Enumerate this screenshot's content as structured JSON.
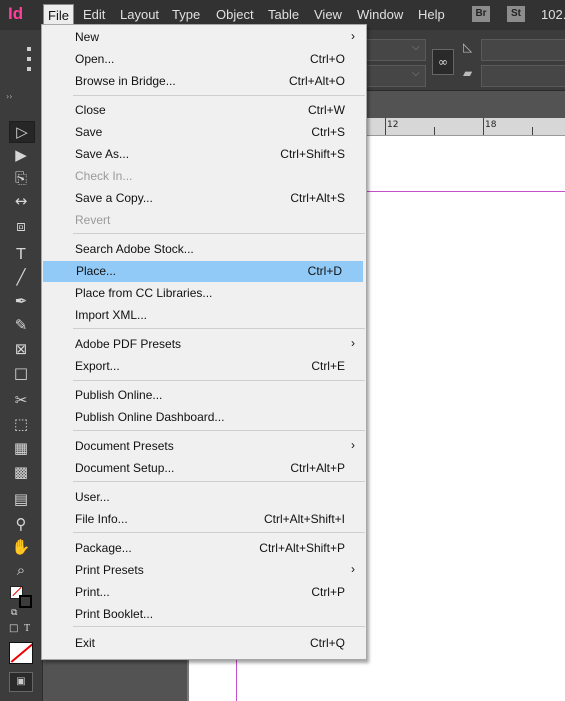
{
  "app": {
    "logo": "Id"
  },
  "menubar": {
    "items": [
      "File",
      "Edit",
      "Layout",
      "Type",
      "Object",
      "Table",
      "View",
      "Window",
      "Help"
    ],
    "badges": [
      "Br",
      "St"
    ],
    "zoom": "102."
  },
  "ruler": {
    "labels": [
      "12",
      "18"
    ]
  },
  "file_menu": {
    "highlighted": "Place...",
    "items": [
      {
        "label": "New",
        "shortcut": "",
        "submenu": true,
        "disabled": false
      },
      {
        "label": "Open...",
        "shortcut": "Ctrl+O",
        "submenu": false,
        "disabled": false
      },
      {
        "label": "Browse in Bridge...",
        "shortcut": "Ctrl+Alt+O",
        "submenu": false,
        "disabled": false
      },
      {
        "label": "Close",
        "shortcut": "Ctrl+W",
        "submenu": false,
        "disabled": false
      },
      {
        "label": "Save",
        "shortcut": "Ctrl+S",
        "submenu": false,
        "disabled": false
      },
      {
        "label": "Save As...",
        "shortcut": "Ctrl+Shift+S",
        "submenu": false,
        "disabled": false
      },
      {
        "label": "Check In...",
        "shortcut": "",
        "submenu": false,
        "disabled": true
      },
      {
        "label": "Save a Copy...",
        "shortcut": "Ctrl+Alt+S",
        "submenu": false,
        "disabled": false
      },
      {
        "label": "Revert",
        "shortcut": "",
        "submenu": false,
        "disabled": true
      },
      {
        "label": "Search Adobe Stock...",
        "shortcut": "",
        "submenu": false,
        "disabled": false
      },
      {
        "label": "Place...",
        "shortcut": "Ctrl+D",
        "submenu": false,
        "disabled": false
      },
      {
        "label": "Place from CC Libraries...",
        "shortcut": "",
        "submenu": false,
        "disabled": false
      },
      {
        "label": "Import XML...",
        "shortcut": "",
        "submenu": false,
        "disabled": false
      },
      {
        "label": "Adobe PDF Presets",
        "shortcut": "",
        "submenu": true,
        "disabled": false
      },
      {
        "label": "Export...",
        "shortcut": "Ctrl+E",
        "submenu": false,
        "disabled": false
      },
      {
        "label": "Publish Online...",
        "shortcut": "",
        "submenu": false,
        "disabled": false
      },
      {
        "label": "Publish Online Dashboard...",
        "shortcut": "",
        "submenu": false,
        "disabled": false
      },
      {
        "label": "Document Presets",
        "shortcut": "",
        "submenu": true,
        "disabled": false
      },
      {
        "label": "Document Setup...",
        "shortcut": "Ctrl+Alt+P",
        "submenu": false,
        "disabled": false
      },
      {
        "label": "User...",
        "shortcut": "",
        "submenu": false,
        "disabled": false
      },
      {
        "label": "File Info...",
        "shortcut": "Ctrl+Alt+Shift+I",
        "submenu": false,
        "disabled": false
      },
      {
        "label": "Package...",
        "shortcut": "Ctrl+Alt+Shift+P",
        "submenu": false,
        "disabled": false
      },
      {
        "label": "Print Presets",
        "shortcut": "",
        "submenu": true,
        "disabled": false
      },
      {
        "label": "Print...",
        "shortcut": "Ctrl+P",
        "submenu": false,
        "disabled": false
      },
      {
        "label": "Print Booklet...",
        "shortcut": "",
        "submenu": false,
        "disabled": false
      },
      {
        "label": "Exit",
        "shortcut": "Ctrl+Q",
        "submenu": false,
        "disabled": false
      }
    ]
  },
  "toolbox": {
    "tools": [
      {
        "name": "selection-tool-icon",
        "glyph": "▷",
        "selected": true
      },
      {
        "name": "direct-selection-tool-icon",
        "glyph": "▶",
        "selected": false
      },
      {
        "name": "page-tool-icon",
        "glyph": "⎘",
        "selected": false
      },
      {
        "name": "gap-tool-icon",
        "glyph": "↔",
        "selected": false
      },
      {
        "name": "content-collector-icon",
        "glyph": "⧈",
        "selected": false
      },
      {
        "name": "type-tool-icon",
        "glyph": "T",
        "selected": false
      },
      {
        "name": "line-tool-icon",
        "glyph": "╱",
        "selected": false
      },
      {
        "name": "pen-tool-icon",
        "glyph": "✒",
        "selected": false
      },
      {
        "name": "pencil-tool-icon",
        "glyph": "✎",
        "selected": false
      },
      {
        "name": "rectangle-frame-tool-icon",
        "glyph": "⊠",
        "selected": false
      },
      {
        "name": "rectangle-tool-icon",
        "glyph": "□",
        "selected": false
      },
      {
        "name": "scissors-tool-icon",
        "glyph": "✂",
        "selected": false
      },
      {
        "name": "free-transform-tool-icon",
        "glyph": "⬚",
        "selected": false
      },
      {
        "name": "gradient-swatch-tool-icon",
        "glyph": "▦",
        "selected": false
      },
      {
        "name": "gradient-feather-tool-icon",
        "glyph": "▩",
        "selected": false
      },
      {
        "name": "note-tool-icon",
        "glyph": "▤",
        "selected": false
      },
      {
        "name": "eyedropper-tool-icon",
        "glyph": "⚲",
        "selected": false
      },
      {
        "name": "hand-tool-icon",
        "glyph": "✋",
        "selected": false
      },
      {
        "name": "zoom-tool-icon",
        "glyph": "⌕",
        "selected": false
      }
    ]
  },
  "colors": {
    "menu_highlight": "#91c9f7",
    "logo": "#ff3e9a",
    "margin_guide": "#c44fc9"
  }
}
